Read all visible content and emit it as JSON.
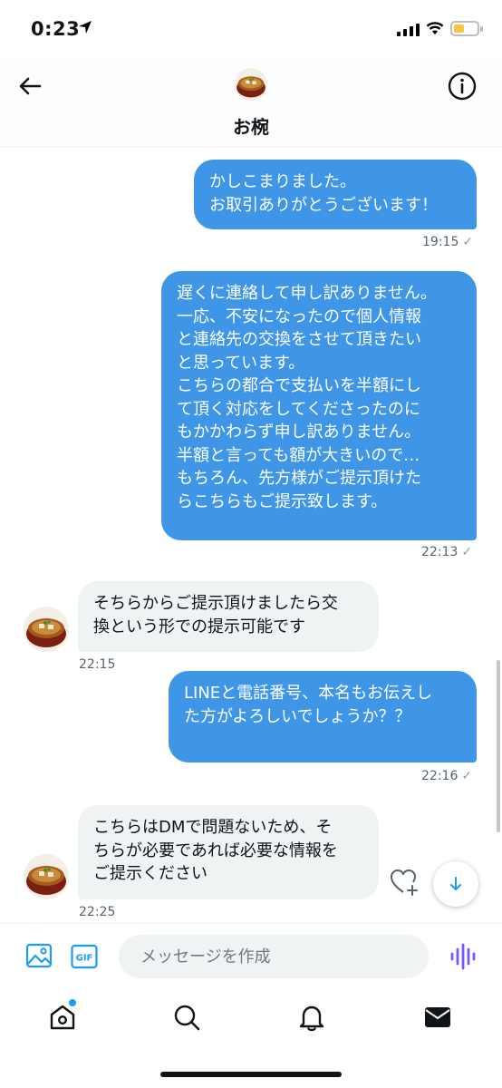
{
  "status": {
    "time": "0:23",
    "battery_color": "#f6c644"
  },
  "header": {
    "title": "お椀",
    "back_icon": "arrow-left-icon",
    "info_icon": "info-icon"
  },
  "messages": [
    {
      "direction": "outgoing",
      "lines": [
        "かしこまりました。",
        "お取引ありがとうございます！"
      ],
      "time": "19:15",
      "status": "✓"
    },
    {
      "direction": "outgoing",
      "lines": [
        "遅くに連絡して申し訳ありません。",
        "一応、不安になったので個人情報",
        "と連絡先の交換をさせて頂きたい",
        "と思っています。",
        "こちらの都合で支払いを半額にし",
        "て頂く対応をしてくださったのに",
        "もかかわらず申し訳ありません。",
        "半額と言っても額が大きいので…",
        "もちろん、先方様がご提示頂けた",
        "らこちらもご提示致します。"
      ],
      "time": "22:13",
      "status": "✓"
    },
    {
      "direction": "incoming",
      "lines": [
        "そちらからご提示頂けましたら交",
        "換という形での提示可能です"
      ],
      "time": "22:15"
    },
    {
      "direction": "outgoing",
      "lines": [
        "LINEと電話番号、本名もお伝えし",
        "た方がよろしいでしょうか？？"
      ],
      "time": "22:16",
      "status": "✓"
    },
    {
      "direction": "incoming",
      "lines": [
        "こちらはDMで問題ないため、そ",
        "ちらが必要であれば必要な情報を",
        "ご提示ください"
      ],
      "time": "22:25"
    }
  ],
  "composer": {
    "placeholder": "メッセージを作成",
    "gif_label": "GIF"
  },
  "colors": {
    "outgoing_bubble": "#3f95e6",
    "incoming_bubble": "#eff3f4",
    "accent": "#1d9bf0",
    "voice": "#7856ff"
  },
  "tabs": [
    "home-icon",
    "search-icon",
    "bell-icon",
    "envelope-icon"
  ]
}
